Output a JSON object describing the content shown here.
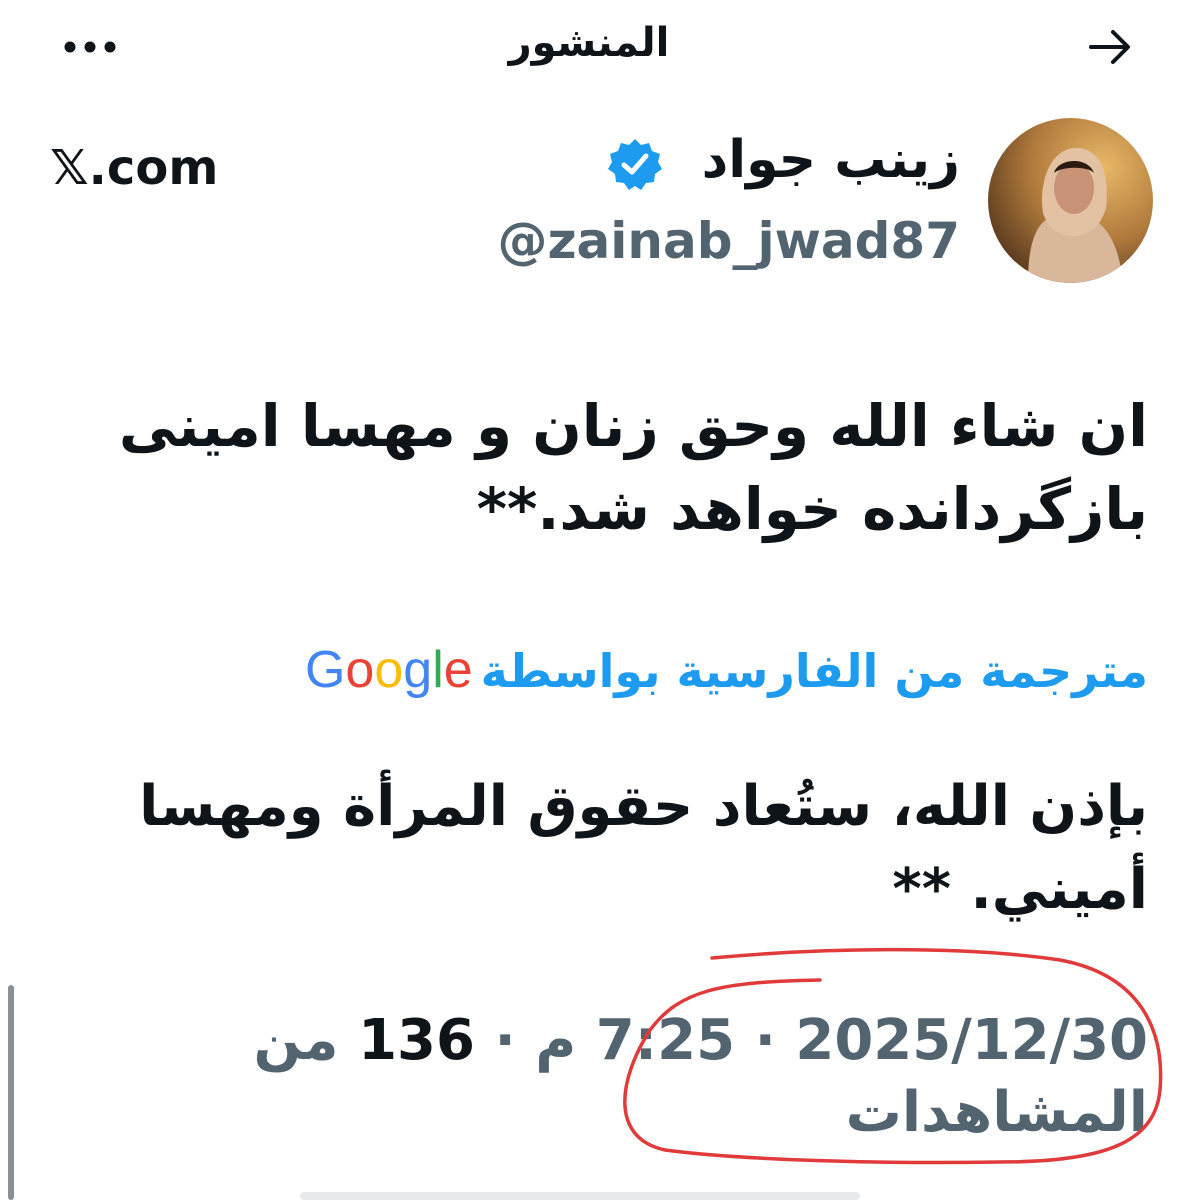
{
  "header": {
    "title": "المنشور",
    "back_icon": "arrow-right-icon",
    "more_icon": "more-dots-icon"
  },
  "author": {
    "display_name": "زينب جواد",
    "handle": "@zainab_jwad87",
    "verified": true,
    "verified_color": "#1d9bf0"
  },
  "watermark": {
    "x_glyph": "𝕏",
    "domain_suffix": ".com"
  },
  "post": {
    "line1": "ان شاء الله وحق  زنان و مهسا امینی",
    "line2": "بازگردانده خواهد شد.**"
  },
  "translation": {
    "label": "مترجمة من الفارسية بواسطة",
    "provider": "Google",
    "line1": "بإذن الله، ستُعاد حقوق المرأة ومهسا",
    "line2": "أميني. **"
  },
  "meta": {
    "date": "2025/12/30",
    "separator": "·",
    "time": "7:25",
    "ampm": "م",
    "views_count": "136",
    "views_label_1": "من",
    "views_label_2": "المشاهدات"
  },
  "colors": {
    "text": "#0f1419",
    "secondary": "#536471",
    "link": "#1d9bf0",
    "annotation": "#e03a3a"
  }
}
